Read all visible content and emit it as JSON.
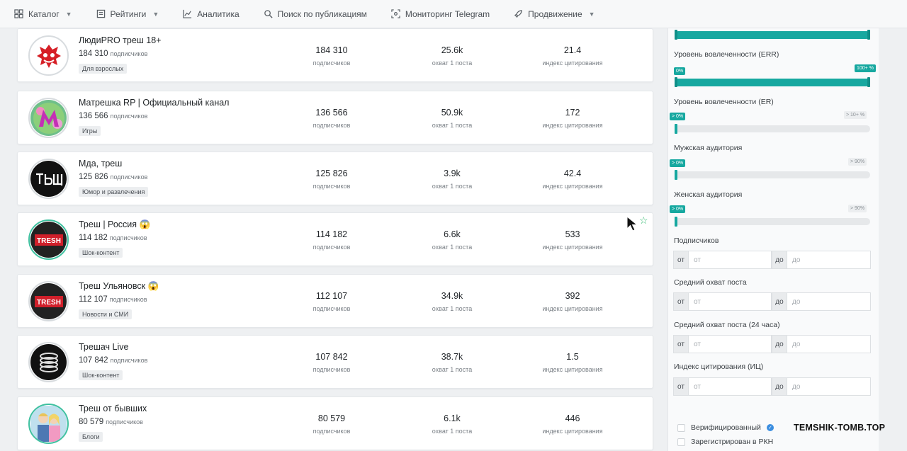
{
  "nav": {
    "catalog": "Каталог",
    "ratings": "Рейтинги",
    "analytics": "Аналитика",
    "search_publications": "Поиск по публикациям",
    "telegram_monitoring": "Мониторинг Telegram",
    "promotion": "Продвижение"
  },
  "channels": [
    {
      "name": "ЛюдиPRO треш 18+",
      "subscribers": "184 310",
      "subs_word": "подписчиков",
      "tag": "Для взрослых",
      "reach": "25.6k",
      "citation": "21.4",
      "avatar_icon": "red-demon-icon"
    },
    {
      "name": "Матрешка RP | Официальный канал",
      "subscribers": "136 566",
      "subs_word": "подписчиков",
      "tag": "Игры",
      "reach": "50.9k",
      "citation": "172",
      "avatar_icon": "matreshka-logo-icon"
    },
    {
      "name": "Мда, треш",
      "subscribers": "125 826",
      "subs_word": "подписчиков",
      "tag": "Юмор и развлечения",
      "reach": "3.9k",
      "citation": "42.4",
      "avatar_icon": "tresh-text-logo"
    },
    {
      "name": "Треш | Россия 😱",
      "subscribers": "114 182",
      "subs_word": "подписчиков",
      "tag": "Шок-контент",
      "reach": "6.6k",
      "citation": "533",
      "avatar_icon": "tresh-red-logo"
    },
    {
      "name": "Треш Ульяновск 😱",
      "subscribers": "112 107",
      "subs_word": "подписчиков",
      "tag": "Новости и СМИ",
      "reach": "34.9k",
      "citation": "392",
      "avatar_icon": "tresh-red-logo"
    },
    {
      "name": "Трешач Live",
      "subscribers": "107 842",
      "subs_word": "подписчиков",
      "tag": "Шок-контент",
      "reach": "38.7k",
      "citation": "1.5",
      "avatar_icon": "tires-icon"
    },
    {
      "name": "Треш от бывших",
      "subscribers": "80 579",
      "subs_word": "подписчиков",
      "tag": "Блоги",
      "reach": "6.1k",
      "citation": "446",
      "avatar_icon": "couple-photo"
    }
  ],
  "metric_labels": {
    "subscribers": "подписчиков",
    "reach": "охват 1 поста",
    "citation": "индекс цитирования"
  },
  "filters": {
    "err_label": "Уровень вовлеченности (ERR)",
    "err_min": "0%",
    "err_max": "100+ %",
    "er_label": "Уровень вовлеченности (ER)",
    "er_min": "> 0%",
    "er_max": "> 10+ %",
    "male_label": "Мужская аудитория",
    "male_min": "> 0%",
    "male_max": "> 90%",
    "female_label": "Женская аудитория",
    "female_min": "> 0%",
    "female_max": "> 90%",
    "subscribers_label": "Подписчиков",
    "avg_reach_label": "Средний охват поста",
    "avg_reach_24_label": "Средний охват поста (24 часа)",
    "citation_label": "Индекс цитирования (ИЦ)",
    "from": "от",
    "to": "до",
    "from_placeholder": "от",
    "to_placeholder": "до",
    "verified_label": "Верифицированный",
    "rkn_label": "Зарегистрирован в РКН"
  },
  "watermark": "TEMSHIK-TOMB.TOP",
  "colors": {
    "accent": "#17a8a0",
    "favorite": "#3dbd77",
    "verified": "#3b8ee0"
  }
}
